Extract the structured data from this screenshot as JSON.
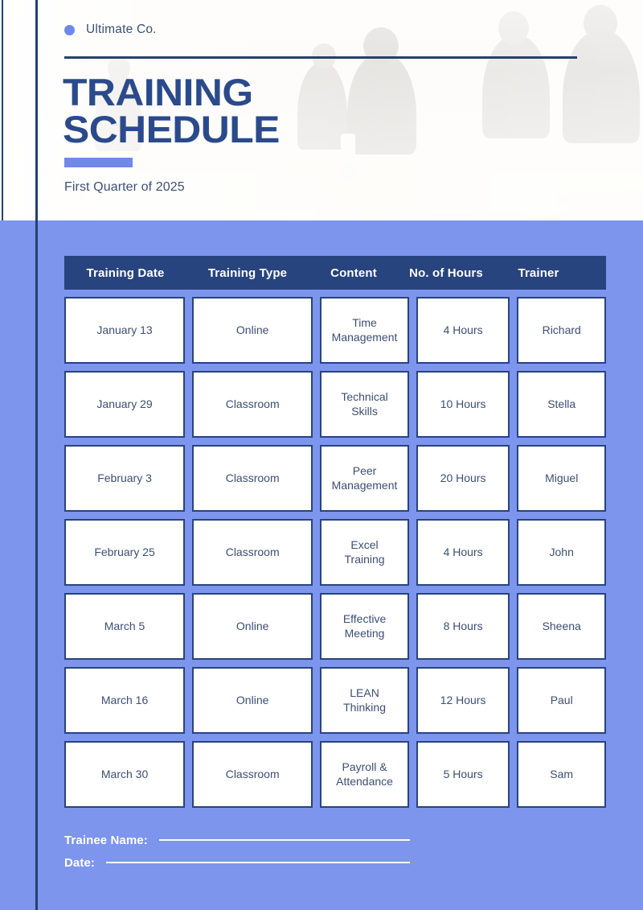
{
  "brand": {
    "name": "Ultimate Co.",
    "dot_color": "#6F88EA"
  },
  "header": {
    "title_line1": "TRAINING",
    "title_line2": "SCHEDULE",
    "subtitle": "First Quarter of 2025",
    "title_color": "#2A4A8B",
    "accent_color": "#6F88EA",
    "rule_color": "#24406E",
    "background_photo": "office-meeting-people-laptops-conference-table"
  },
  "theme": {
    "page_background": "#7D95EC",
    "header_background": "#FBF8F2",
    "table_header_background": "#27447E",
    "cell_background": "#FFFFFF",
    "cell_border": "#27447E",
    "cell_text": "#3C4F73"
  },
  "table": {
    "columns": [
      "Training Date",
      "Training Type",
      "Content",
      "No. of Hours",
      "Trainer"
    ],
    "rows": [
      [
        "January 13",
        "Online",
        "Time\nManagement",
        "4 Hours",
        "Richard"
      ],
      [
        "January 29",
        "Classroom",
        "Technical\nSkills",
        "10 Hours",
        "Stella"
      ],
      [
        "February 3",
        "Classroom",
        "Peer\nManagement",
        "20 Hours",
        "Miguel"
      ],
      [
        "February 25",
        "Classroom",
        "Excel\nTraining",
        "4 Hours",
        "John"
      ],
      [
        "March 5",
        "Online",
        "Effective\nMeeting",
        "8 Hours",
        "Sheena"
      ],
      [
        "March 16",
        "Online",
        "LEAN\nThinking",
        "12 Hours",
        "Paul"
      ],
      [
        "March 30",
        "Classroom",
        "Payroll &\nAttendance",
        "5 Hours",
        "Sam"
      ]
    ]
  },
  "footer": {
    "trainee_label": "Trainee Name:",
    "date_label": "Date:"
  }
}
